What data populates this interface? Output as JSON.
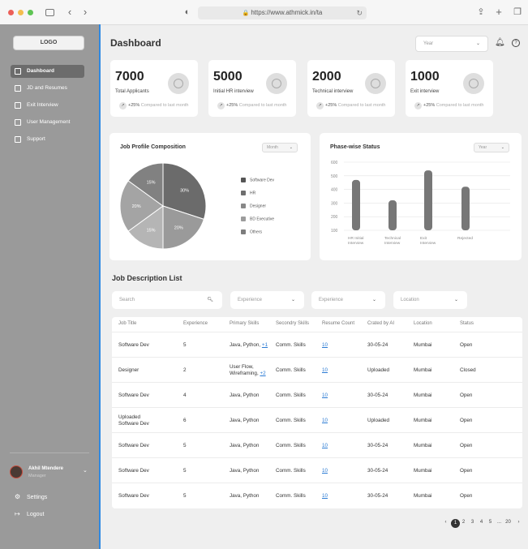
{
  "browser": {
    "url": "https://www.athmick.in/ta"
  },
  "sidebar": {
    "logo": "LOGO",
    "items": [
      {
        "label": "Dashboard",
        "icon": "grid-icon"
      },
      {
        "label": "JD and Resumes",
        "icon": "building-icon"
      },
      {
        "label": "Exit Interview",
        "icon": "building-icon"
      },
      {
        "label": "User Management",
        "icon": "building-icon"
      },
      {
        "label": "Support",
        "icon": "document-icon"
      }
    ],
    "user": {
      "name": "Akhil Mtendere",
      "role": "Manager"
    },
    "settings": "Settings",
    "logout": "Logout"
  },
  "header": {
    "title": "Dashboard",
    "year_placeholder": "Year"
  },
  "stats": [
    {
      "value": "7000",
      "label": "Total Applicants",
      "change": "+25%",
      "compare": "Compared to last month"
    },
    {
      "value": "5000",
      "label": "Initial HR interview",
      "change": "+25%",
      "compare": "Compared to last month"
    },
    {
      "value": "2000",
      "label": "Technical interview",
      "change": "+25%",
      "compare": "Compared to last month"
    },
    {
      "value": "1000",
      "label": "Exit interview",
      "change": "+25%",
      "compare": "Compared to last month"
    }
  ],
  "pie_card": {
    "title": "Job Profile Composition",
    "select": "Month"
  },
  "bar_card": {
    "title": "Phase-wise Status",
    "select": "Year"
  },
  "chart_data": [
    {
      "type": "pie",
      "title": "Job Profile Composition",
      "slices": [
        {
          "label": "30%",
          "value": 30,
          "color": "#6b6b6b"
        },
        {
          "label": "20%",
          "value": 20,
          "color": "#9a9a9a"
        },
        {
          "label": "15%",
          "value": 15,
          "color": "#b5b5b5"
        },
        {
          "label": "20%",
          "value": 20,
          "color": "#a4a4a4"
        },
        {
          "label": "15%",
          "value": 15,
          "color": "#818181"
        }
      ],
      "legend": [
        {
          "name": "Software Dev",
          "color": "#555555"
        },
        {
          "name": "HR",
          "color": "#6e6e6e"
        },
        {
          "name": "Designer",
          "color": "#888888"
        },
        {
          "name": "BD Executive",
          "color": "#9c9c9c"
        },
        {
          "name": "Others",
          "color": "#7d7d7d"
        }
      ]
    },
    {
      "type": "bar",
      "title": "Phase-wise Status",
      "categories": [
        [
          "HR Initial",
          "Interview"
        ],
        [
          "Technical",
          "Interview"
        ],
        [
          "Exit",
          "Interview"
        ],
        [
          "Rejected"
        ]
      ],
      "values": [
        470,
        320,
        540,
        420
      ],
      "ylim": [
        100,
        600
      ],
      "yticks": [
        100,
        200,
        300,
        400,
        500,
        600
      ],
      "grid": true
    }
  ],
  "jobs": {
    "title": "Job Description List",
    "search_placeholder": "Search",
    "filters": [
      "Experience",
      "Experience",
      "Location"
    ],
    "columns": [
      "Job Title",
      "Experience",
      "Primary Skills",
      "Secondry Skills",
      "Resume Count",
      "Crated by AI",
      "Location",
      "Status"
    ],
    "rows": [
      {
        "title": [
          "Software Dev"
        ],
        "exp": "5",
        "skills": [
          "Java, Python, "
        ],
        "more": "+1",
        "secondary": "Comm. Skills",
        "count": "10",
        "ai": "30-05-24",
        "location": "Mumbai",
        "status": "Open"
      },
      {
        "title": [
          "Designer"
        ],
        "exp": "2",
        "skills": [
          "User Flow,",
          "Wireframing, "
        ],
        "more": "+2",
        "secondary": "Comm. Skills",
        "count": "10",
        "ai": "Uploaded",
        "location": "Mumbai",
        "status": "Closed"
      },
      {
        "title": [
          "Software Dev"
        ],
        "exp": "4",
        "skills": [
          "Java, Python"
        ],
        "more": "",
        "secondary": "Comm. Skills",
        "count": "10",
        "ai": "30-05-24",
        "location": "Mumbai",
        "status": "Open"
      },
      {
        "title": [
          "Uploaded",
          "Software Dev"
        ],
        "exp": "6",
        "skills": [
          "Java, Python"
        ],
        "more": "",
        "secondary": "Comm. Skills",
        "count": "10",
        "ai": "Uploaded",
        "location": "Mumbai",
        "status": "Open"
      },
      {
        "title": [
          "Software Dev"
        ],
        "exp": "5",
        "skills": [
          "Java, Python"
        ],
        "more": "",
        "secondary": "Comm. Skills",
        "count": "10",
        "ai": "30-05-24",
        "location": "Mumbai",
        "status": "Open"
      },
      {
        "title": [
          "Software Dev"
        ],
        "exp": "5",
        "skills": [
          "Java, Python"
        ],
        "more": "",
        "secondary": "Comm. Skills",
        "count": "10",
        "ai": "30-05-24",
        "location": "Mumbai",
        "status": "Open"
      },
      {
        "title": [
          "Software Dev"
        ],
        "exp": "5",
        "skills": [
          "Java, Python"
        ],
        "more": "",
        "secondary": "Comm. Skills",
        "count": "10",
        "ai": "30-05-24",
        "location": "Mumbai",
        "status": "Open"
      }
    ]
  },
  "pagination": {
    "prev": "‹",
    "pages": [
      "1",
      "2",
      "3",
      "4",
      "5",
      "...",
      "20"
    ],
    "current": "1",
    "next": "›"
  }
}
